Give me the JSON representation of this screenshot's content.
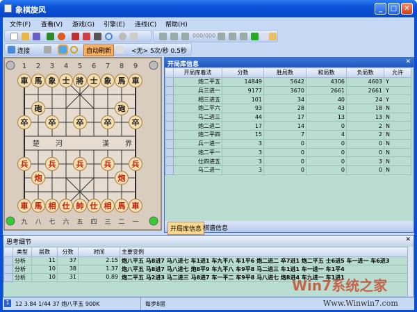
{
  "window": {
    "title": "象棋旋风",
    "buttons": [
      "_",
      "□",
      "✕"
    ]
  },
  "menu": [
    "文件(F)",
    "查看(V)",
    "游戏(G)",
    "引擎(E)",
    "连线(C)",
    "帮助(H)"
  ],
  "toolbar": {
    "move_counter": "000/000",
    "connect_label": "连接",
    "auto_refresh_label": "自动刷新",
    "speed_text": "<无> 5次/秒 0.5秒"
  },
  "board": {
    "top_numbers": [
      "1",
      "2",
      "3",
      "4",
      "5",
      "6",
      "7",
      "8",
      "9"
    ],
    "bottom_numbers": [
      "九",
      "八",
      "七",
      "六",
      "五",
      "四",
      "三",
      "二",
      "一"
    ],
    "river": [
      "楚",
      "河",
      "漢",
      "界"
    ],
    "pieces": [
      {
        "c": "車",
        "f": 0,
        "r": 0,
        "red": false
      },
      {
        "c": "馬",
        "f": 1,
        "r": 0,
        "red": false
      },
      {
        "c": "象",
        "f": 2,
        "r": 0,
        "red": false
      },
      {
        "c": "士",
        "f": 3,
        "r": 0,
        "red": false
      },
      {
        "c": "將",
        "f": 4,
        "r": 0,
        "red": false
      },
      {
        "c": "士",
        "f": 5,
        "r": 0,
        "red": false
      },
      {
        "c": "象",
        "f": 6,
        "r": 0,
        "red": false
      },
      {
        "c": "馬",
        "f": 7,
        "r": 0,
        "red": false
      },
      {
        "c": "車",
        "f": 8,
        "r": 0,
        "red": false
      },
      {
        "c": "砲",
        "f": 1,
        "r": 2,
        "red": false
      },
      {
        "c": "砲",
        "f": 7,
        "r": 2,
        "red": false
      },
      {
        "c": "卒",
        "f": 0,
        "r": 3,
        "red": false
      },
      {
        "c": "卒",
        "f": 2,
        "r": 3,
        "red": false
      },
      {
        "c": "卒",
        "f": 4,
        "r": 3,
        "red": false
      },
      {
        "c": "卒",
        "f": 6,
        "r": 3,
        "red": false
      },
      {
        "c": "卒",
        "f": 8,
        "r": 3,
        "red": false
      },
      {
        "c": "兵",
        "f": 0,
        "r": 6,
        "red": true
      },
      {
        "c": "兵",
        "f": 2,
        "r": 6,
        "red": true
      },
      {
        "c": "兵",
        "f": 4,
        "r": 6,
        "red": true
      },
      {
        "c": "兵",
        "f": 6,
        "r": 6,
        "red": true
      },
      {
        "c": "兵",
        "f": 8,
        "r": 6,
        "red": true
      },
      {
        "c": "炮",
        "f": 1,
        "r": 7,
        "red": true
      },
      {
        "c": "炮",
        "f": 7,
        "r": 7,
        "red": true
      },
      {
        "c": "車",
        "f": 0,
        "r": 9,
        "red": true
      },
      {
        "c": "馬",
        "f": 1,
        "r": 9,
        "red": true
      },
      {
        "c": "相",
        "f": 2,
        "r": 9,
        "red": true
      },
      {
        "c": "仕",
        "f": 3,
        "r": 9,
        "red": true
      },
      {
        "c": "帥",
        "f": 4,
        "r": 9,
        "red": true
      },
      {
        "c": "仕",
        "f": 5,
        "r": 9,
        "red": true
      },
      {
        "c": "相",
        "f": 6,
        "r": 9,
        "red": true
      },
      {
        "c": "馬",
        "f": 7,
        "r": 9,
        "red": true
      },
      {
        "c": "車",
        "f": 8,
        "r": 9,
        "red": true
      }
    ]
  },
  "opening": {
    "title": "开局库信息",
    "columns": [
      "开局库着法",
      "分数",
      "胜局数",
      "和局数",
      "负局数",
      "允许"
    ],
    "rows": [
      [
        "炮二平五",
        "14849",
        "5642",
        "4306",
        "4603",
        "Y"
      ],
      [
        "兵三进一",
        "9177",
        "3670",
        "2661",
        "2661",
        "Y"
      ],
      [
        "相三进五",
        "101",
        "34",
        "40",
        "24",
        "Y"
      ],
      [
        "炮二平六",
        "93",
        "28",
        "43",
        "18",
        "N"
      ],
      [
        "马二进三",
        "44",
        "17",
        "13",
        "13",
        "N"
      ],
      [
        "炮二进二",
        "17",
        "14",
        "0",
        "2",
        "N"
      ],
      [
        "炮二平四",
        "15",
        "7",
        "4",
        "2",
        "N"
      ],
      [
        "兵一进一",
        "3",
        "0",
        "0",
        "0",
        "N"
      ],
      [
        "炮二平一",
        "3",
        "0",
        "0",
        "0",
        "N"
      ],
      [
        "仕四进五",
        "3",
        "0",
        "0",
        "3",
        "N"
      ],
      [
        "马二进一",
        "3",
        "0",
        "0",
        "0",
        "N"
      ]
    ],
    "tabs": [
      "开局库信息",
      "棋谱信息"
    ]
  },
  "thinking": {
    "title": "思考细节",
    "columns": [
      "类型",
      "层数",
      "分数",
      "时间",
      "主要变例"
    ],
    "rows": [
      [
        "分析",
        "11",
        "37",
        "2.15",
        "炮八平五 马8进7 马八进七 车1进1 车九平八 车1平6 炮二进二 卒7进1 炮二平五 士6进5 车一进一 车6进3"
      ],
      [
        "分析",
        "10",
        "38",
        "1.37",
        "炮八平五 马8进7 马八进七 炮8平9 车九平八 车9平8 马二进三 车1进1 车一进一 车1平4"
      ],
      [
        "分析",
        "10",
        "31",
        "0.89",
        "炮二平五 马2进3 马二进三 马8进7 车一平二 车9平8 马八进七 炮8进4 车九进一 车1进1"
      ]
    ]
  },
  "status": {
    "engine_line": "12 3.84 1/44 37 炮八平五 900K",
    "depth": "每步8层"
  },
  "watermark": {
    "logo": "Win7系统之家",
    "url": "Www.Winwin7.com"
  }
}
